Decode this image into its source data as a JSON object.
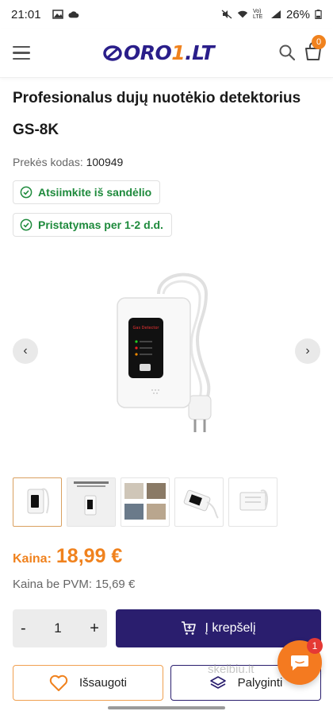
{
  "status_bar": {
    "time": "21:01",
    "battery": "26%",
    "network": "Vo) LTE"
  },
  "header": {
    "logo_text_a": "ORO",
    "logo_text_b": "1",
    "logo_text_c": ".LT",
    "cart_count": "0",
    "brand_color": "#2a1e8a",
    "accent_color": "#f0821e"
  },
  "product": {
    "title": "Profesionalus dujų nuotėkio detektorius GS-8K",
    "sku_label": "Prekės kodas:",
    "sku_value": "100949",
    "badges": [
      {
        "label": "Atsiimkite iš sandėlio"
      },
      {
        "label": "Pristatymas per 1-2 d.d."
      }
    ],
    "device_label": "Gas Detector",
    "thumbnails": [
      {
        "name": "thumb-1",
        "active": true
      },
      {
        "name": "thumb-2",
        "active": false
      },
      {
        "name": "thumb-3",
        "active": false
      },
      {
        "name": "thumb-4",
        "active": false
      },
      {
        "name": "thumb-5",
        "active": false
      }
    ]
  },
  "pricing": {
    "price_label": "Kaina:",
    "price_value": "18,99 €",
    "no_vat_label": "Kaina be PVM:",
    "no_vat_value": "15,69 €"
  },
  "actions": {
    "qty_minus": "-",
    "qty_value": "1",
    "qty_plus": "+",
    "add_to_cart": "Į krepšelį",
    "save": "Išsaugoti",
    "compare": "Palyginti"
  },
  "chat": {
    "badge": "1"
  },
  "watermark": "skelbiu.lt"
}
